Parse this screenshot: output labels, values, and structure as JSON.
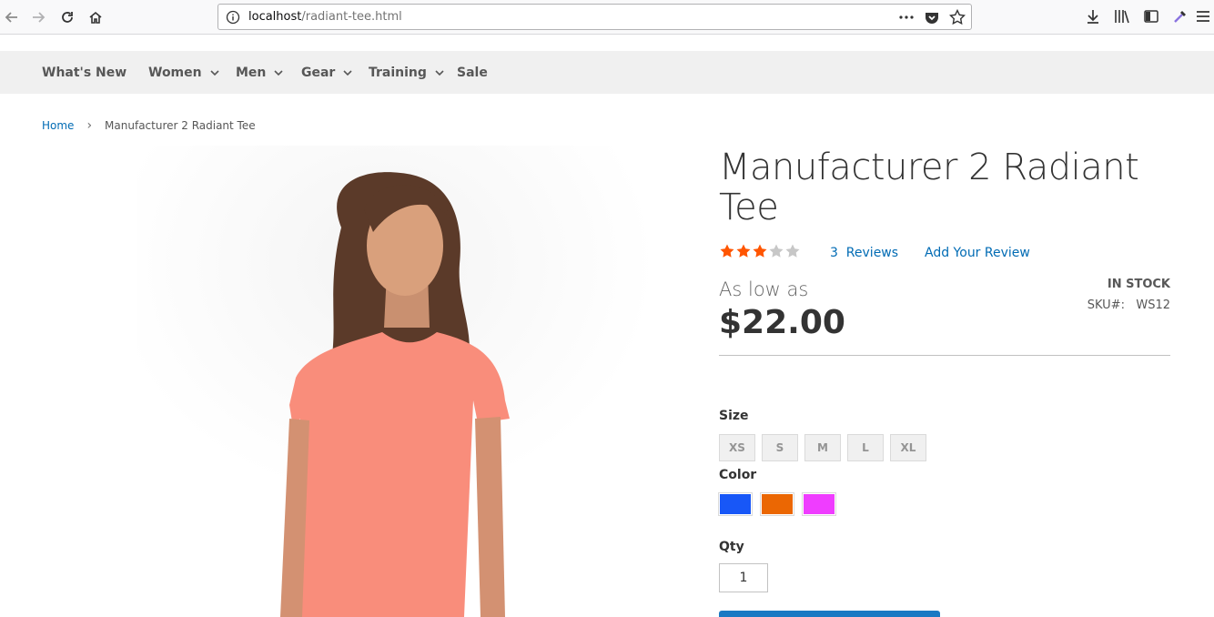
{
  "browser": {
    "url_host": "localhost",
    "url_path": "/radiant-tee.html"
  },
  "nav": {
    "items": [
      {
        "label": "What's New",
        "has_dropdown": false
      },
      {
        "label": "Women",
        "has_dropdown": true
      },
      {
        "label": "Men",
        "has_dropdown": true
      },
      {
        "label": "Gear",
        "has_dropdown": true
      },
      {
        "label": "Training",
        "has_dropdown": true
      },
      {
        "label": "Sale",
        "has_dropdown": false
      }
    ]
  },
  "breadcrumb": {
    "home": "Home",
    "separator": "›",
    "current": "Manufacturer 2 Radiant Tee"
  },
  "product": {
    "title": "Manufacturer 2 Radiant Tee",
    "rating": 3,
    "rating_max": 5,
    "reviews_label": "3  Reviews",
    "add_review_label": "Add Your Review",
    "price_prefix": "As low as",
    "price": "$22.00",
    "stock": "IN STOCK",
    "sku_label": "SKU#:   WS12",
    "size_label": "Size",
    "sizes": [
      "XS",
      "S",
      "M",
      "L",
      "XL"
    ],
    "color_label": "Color",
    "colors": [
      "#1857f7",
      "#eb6703",
      "#ef3dff"
    ],
    "qty_label": "Qty",
    "qty_value": "1"
  },
  "colors": {
    "link": "#006bb4",
    "star_on": "#ff5501",
    "star_off": "#c7c7c7",
    "primary_button": "#1979c3"
  }
}
